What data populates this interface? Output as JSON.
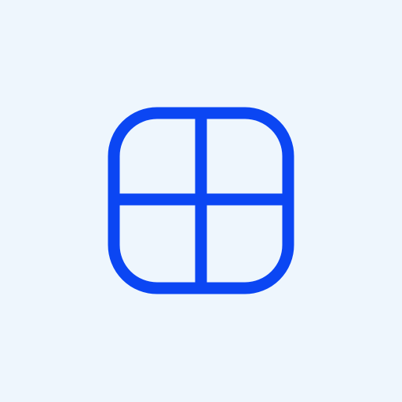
{
  "icon": {
    "name": "grid-layout-icon",
    "stroke_color": "#0b46f3",
    "background_color": "#eef6fd"
  }
}
